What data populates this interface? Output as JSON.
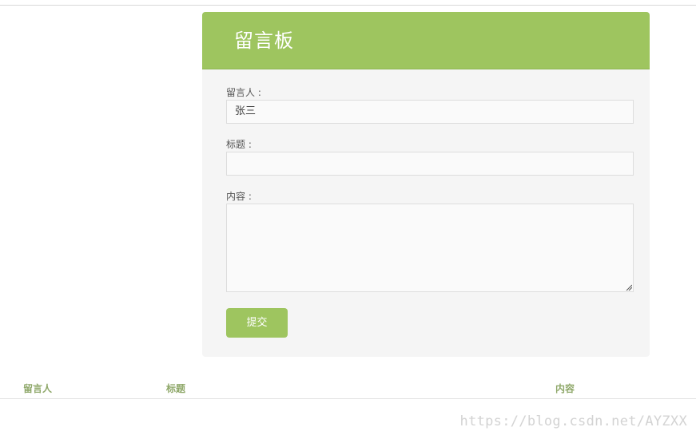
{
  "board": {
    "title": "留言板"
  },
  "form": {
    "author_label": "留言人 :",
    "author_value": "张三",
    "title_label": "标题 :",
    "title_value": "",
    "content_label": "内容 :",
    "content_value": "",
    "submit_label": "提交"
  },
  "table": {
    "columns": [
      "留言人",
      "标题",
      "内容"
    ]
  },
  "watermark": "https://blog.csdn.net/AYZXX",
  "colors": {
    "accent": "#9ec55f",
    "header_text": "#8fa86a",
    "panel_bg": "#f5f5f5"
  }
}
